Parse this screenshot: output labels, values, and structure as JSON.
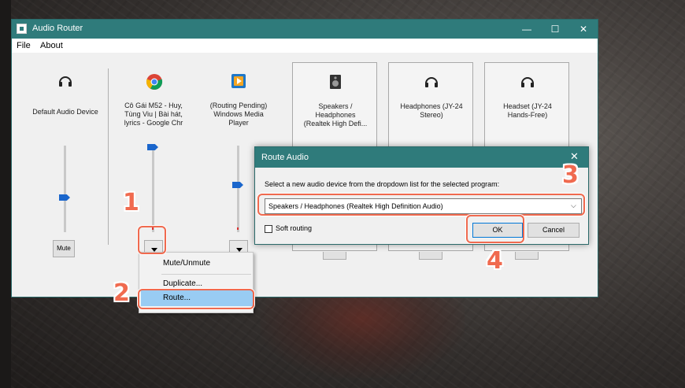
{
  "window": {
    "title": "Audio Router",
    "controls": {
      "minimize": "—",
      "maximize": "☐",
      "close": "✕"
    },
    "menu": [
      "File",
      "About"
    ]
  },
  "devices": [
    {
      "label": "Default Audio Device",
      "icon": "headphones-icon",
      "mute_label": "Mute"
    },
    {
      "label": "Cô Gái M52 - Huy,\nTùng Viu | Bài hát,\nlyrics - Google Chr",
      "icon": "chrome-icon"
    },
    {
      "label": "(Routing Pending)\nWindows Media\nPlayer",
      "icon": "media-player-icon"
    },
    {
      "label": "Speakers /\nHeadphones\n(Realtek High Defi...",
      "icon": "speaker-icon"
    },
    {
      "label": "Headphones (JY-24\nStereo)",
      "icon": "headphones-icon"
    },
    {
      "label": "Headset (JY-24\nHands-Free)",
      "icon": "headphones-icon"
    }
  ],
  "context_menu": {
    "items": [
      "Mute/Unmute",
      "Duplicate...",
      "Route..."
    ],
    "selected": "Route..."
  },
  "dialog": {
    "title": "Route Audio",
    "close": "✕",
    "instruction": "Select a new audio device from the dropdown list for the selected program:",
    "selected_device": "Speakers / Headphones (Realtek High Definition Audio)",
    "soft_routing_label": "Soft routing",
    "soft_routing_checked": false,
    "ok_label": "OK",
    "cancel_label": "Cancel"
  },
  "annotations": {
    "color": "#f06a4f",
    "steps": [
      "1",
      "2",
      "3",
      "4"
    ]
  },
  "colors": {
    "titlebar": "#2f7b7b",
    "slider_thumb": "#1a66cc",
    "route_highlight": "#99ccf3"
  }
}
